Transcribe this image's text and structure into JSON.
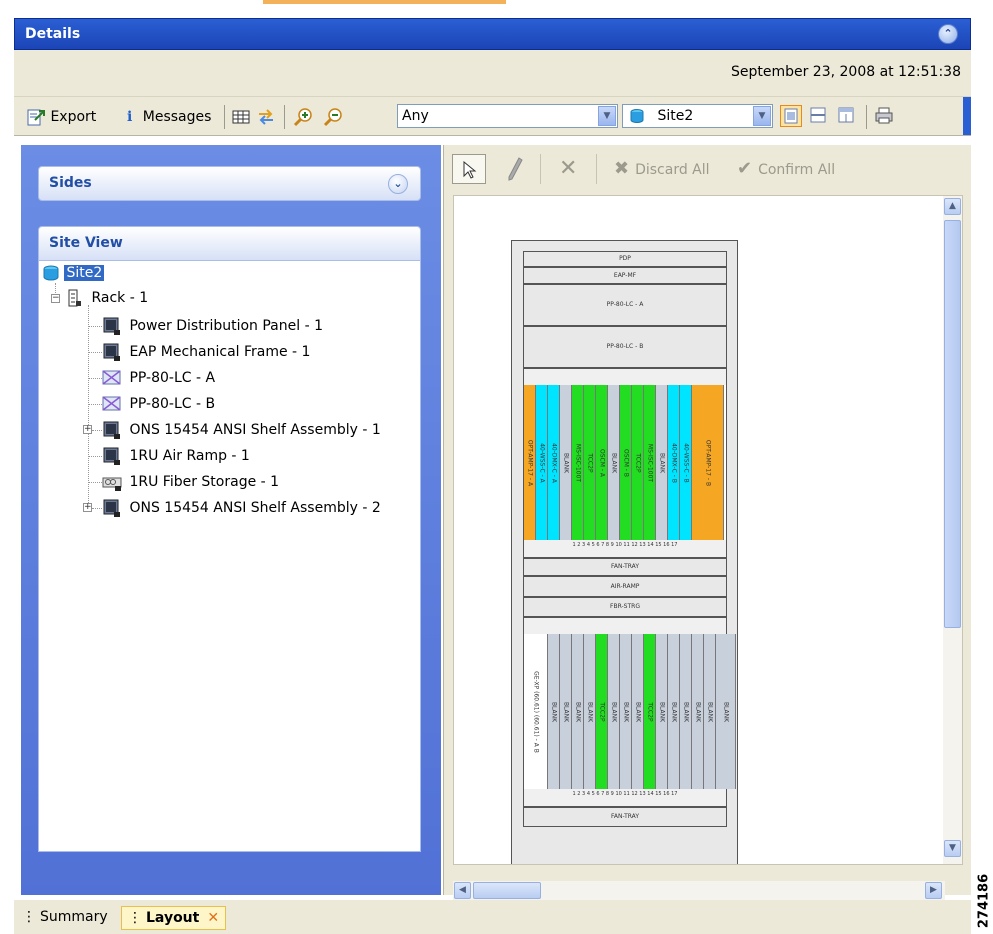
{
  "window": {
    "title": "Details"
  },
  "datebar": {
    "timestamp": "September 23, 2008 at 12:51:38"
  },
  "toolbar": {
    "export_label": "Export",
    "messages_label": "Messages",
    "filter_value": "Any",
    "site_value": "Site2"
  },
  "sides_panel": {
    "title": "Sides"
  },
  "site_view": {
    "title": "Site View",
    "root": "Site2",
    "rack": "Rack - 1",
    "items": [
      "Power Distribution Panel - 1",
      "EAP Mechanical Frame - 1",
      "PP-80-LC - A",
      "PP-80-LC - B",
      "ONS 15454 ANSI Shelf Assembly - 1",
      "1RU Air Ramp - 1",
      "1RU Fiber Storage - 1",
      "ONS 15454 ANSI Shelf Assembly - 2"
    ]
  },
  "layout_toolbar": {
    "discard_label": "Discard All",
    "confirm_label": "Confirm All"
  },
  "rack": {
    "rows": [
      "PDP",
      "EAP-MF",
      "PP-80-LC - A",
      "PP-80-LC - B",
      "FAN-TRAY",
      "AIR-RAMP",
      "FBR-STRG",
      "FAN-TRAY"
    ],
    "shelf1_cards": [
      {
        "label": "OPT-AMP-17 - A",
        "color": "#f5a623"
      },
      {
        "label": "40-WSS-C - A",
        "color": "#00e5ff"
      },
      {
        "label": "40-DMX-C - A",
        "color": "#00e5ff"
      },
      {
        "label": "BLANK",
        "color": "#c8d0dc"
      },
      {
        "label": "MS-ISC-100T",
        "color": "#22dd22"
      },
      {
        "label": "TCC2P",
        "color": "#22dd22"
      },
      {
        "label": "OSCM - A",
        "color": "#22dd22"
      },
      {
        "label": "BLANK",
        "color": "#c8d0dc"
      },
      {
        "label": "OSCM - B",
        "color": "#22dd22"
      },
      {
        "label": "TCC2P",
        "color": "#22dd22"
      },
      {
        "label": "MS-ISC-100T",
        "color": "#22dd22"
      },
      {
        "label": "BLANK",
        "color": "#c8d0dc"
      },
      {
        "label": "40-DMX-C - B",
        "color": "#00e5ff"
      },
      {
        "label": "40-WSS-C - B",
        "color": "#00e5ff"
      },
      {
        "label": "OPT-AMP-17 - B",
        "color": "#f5a623"
      }
    ],
    "shelf2_cards": [
      {
        "label": "GE-XP (60.61) (60.61) - A B",
        "color": "#ffffff"
      },
      {
        "label": "BLANK",
        "color": "#c8d0dc"
      },
      {
        "label": "BLANK",
        "color": "#c8d0dc"
      },
      {
        "label": "BLANK",
        "color": "#c8d0dc"
      },
      {
        "label": "BLANK",
        "color": "#c8d0dc"
      },
      {
        "label": "TCC2P",
        "color": "#22dd22"
      },
      {
        "label": "BLANK",
        "color": "#c8d0dc"
      },
      {
        "label": "BLANK",
        "color": "#c8d0dc"
      },
      {
        "label": "BLANK",
        "color": "#c8d0dc"
      },
      {
        "label": "TCC2P",
        "color": "#22dd22"
      },
      {
        "label": "BLANK",
        "color": "#c8d0dc"
      },
      {
        "label": "BLANK",
        "color": "#c8d0dc"
      },
      {
        "label": "BLANK",
        "color": "#c8d0dc"
      },
      {
        "label": "BLANK",
        "color": "#c8d0dc"
      },
      {
        "label": "BLANK",
        "color": "#c8d0dc"
      },
      {
        "label": "BLANK",
        "color": "#c8d0dc"
      }
    ],
    "slot_numbers": "1 2 3 4 5 6 7 8 9 10 11 12 13 14 15 16 17"
  },
  "bottom_tabs": {
    "summary": "Summary",
    "layout": "Layout"
  },
  "figure_id": "274186"
}
